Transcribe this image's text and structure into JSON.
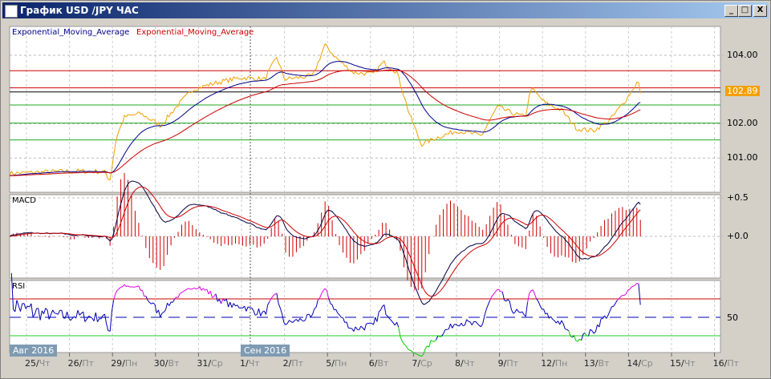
{
  "window": {
    "title": "График USD /JPY  ЧАС",
    "minimize": "_",
    "maximize": "□",
    "close": "X"
  },
  "legend": {
    "ema1": "Exponential_Moving_Average",
    "ema2": "Exponential_Moving_Average"
  },
  "panels": {
    "macd": "MACD",
    "rsi": "RSI"
  },
  "colors": {
    "price": "#f0a000",
    "ema_fast": "#00008b",
    "ema_slow": "#cc0000",
    "macd_signal": "#cc0000",
    "macd": "#000040",
    "rsi": "#0000b0",
    "rsi_over": "#e000e0",
    "rsi_under": "#00cc00"
  },
  "chart_data": [
    {
      "type": "line",
      "title": "USD/JPY ЧАС",
      "ylim": [
        100.2,
        104.5
      ],
      "yticks": [
        "104.00",
        "102.00",
        "101.00"
      ],
      "last_price": "102.89",
      "x_unit": "trading-day index (0 = 25 Aug)",
      "price_keyframes": [
        [
          -0.39,
          100.55
        ],
        [
          0.5,
          100.6
        ],
        [
          1.25,
          100.62
        ],
        [
          1.81,
          100.6
        ],
        [
          1.94,
          100.35
        ],
        [
          2.09,
          101.6
        ],
        [
          2.28,
          102.2
        ],
        [
          2.65,
          102.3
        ],
        [
          3.12,
          101.95
        ],
        [
          3.49,
          102.5
        ],
        [
          3.86,
          103.0
        ],
        [
          4.42,
          103.2
        ],
        [
          4.98,
          103.35
        ],
        [
          5.54,
          103.3
        ],
        [
          5.82,
          103.95
        ],
        [
          6.0,
          103.3
        ],
        [
          6.66,
          103.4
        ],
        [
          6.94,
          104.3
        ],
        [
          7.22,
          103.9
        ],
        [
          7.59,
          103.5
        ],
        [
          8.06,
          103.45
        ],
        [
          8.3,
          103.8
        ],
        [
          8.62,
          103.5
        ],
        [
          8.9,
          102.3
        ],
        [
          9.18,
          101.4
        ],
        [
          9.55,
          101.6
        ],
        [
          10.02,
          101.8
        ],
        [
          10.58,
          101.65
        ],
        [
          10.95,
          102.5
        ],
        [
          11.32,
          102.3
        ],
        [
          11.6,
          102.2
        ],
        [
          11.73,
          103.05
        ],
        [
          12.07,
          102.6
        ],
        [
          12.44,
          102.4
        ],
        [
          12.81,
          101.85
        ],
        [
          13.19,
          101.8
        ],
        [
          13.56,
          102.1
        ],
        [
          13.94,
          102.7
        ],
        [
          14.22,
          103.25
        ],
        [
          14.31,
          102.89
        ]
      ],
      "hlines": [
        {
          "value": 103.55,
          "color": "#cc0000"
        },
        {
          "value": 103.05,
          "color": "#cc0000"
        },
        {
          "value": 102.93,
          "color": "#000000"
        },
        {
          "value": 102.55,
          "color": "#22aa22"
        },
        {
          "value": 102.02,
          "color": "#22aa22"
        },
        {
          "value": 101.53,
          "color": "#22aa22"
        }
      ],
      "series": [
        {
          "name": "Exponential_Moving_Average",
          "period": 24
        },
        {
          "name": "Exponential_Moving_Average",
          "period": 60
        }
      ]
    },
    {
      "type": "line",
      "title": "MACD",
      "yticks": [
        "+0.5",
        "+0.0"
      ],
      "ylim": [
        -0.55,
        0.55
      ],
      "params": [
        12,
        26,
        9
      ]
    },
    {
      "type": "line",
      "title": "RSI",
      "yticks": [
        "50"
      ],
      "ylim": [
        0,
        100
      ],
      "levels": [
        70,
        50,
        30
      ],
      "period": 14
    }
  ],
  "xaxis": {
    "months": [
      "Авг 2016",
      "Сен 2016"
    ],
    "days": [
      [
        "25",
        "Чт"
      ],
      [
        "26",
        "Пт"
      ],
      [
        "29",
        "Пн"
      ],
      [
        "30",
        "Вт"
      ],
      [
        "31",
        "Ср"
      ],
      [
        "1",
        "Чт"
      ],
      [
        "2",
        "Пт"
      ],
      [
        "5",
        "Пн"
      ],
      [
        "6",
        "Вт"
      ],
      [
        "7",
        "Ср"
      ],
      [
        "8",
        "Чт"
      ],
      [
        "9",
        "Пт"
      ],
      [
        "12",
        "Пн"
      ],
      [
        "13",
        "Вт"
      ],
      [
        "14",
        "Ср"
      ],
      [
        "15",
        "Чт"
      ],
      [
        "16",
        "Пт"
      ]
    ]
  }
}
